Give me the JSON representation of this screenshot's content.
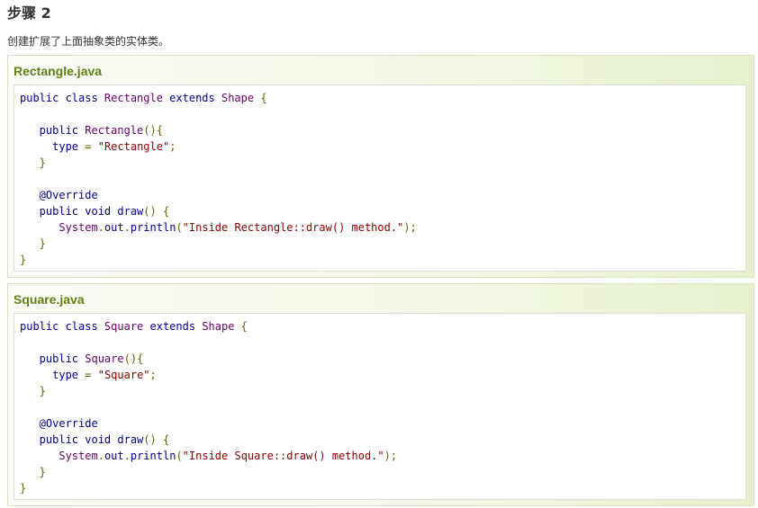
{
  "step": {
    "title": "步骤 2",
    "description": "创建扩展了上面抽象类的实体类。"
  },
  "examples": [
    {
      "filename": "Rectangle.java",
      "lines": [
        [
          {
            "t": "public class ",
            "c": "kw"
          },
          {
            "t": "Rectangle",
            "c": "ty"
          },
          {
            "t": " extends ",
            "c": "kw"
          },
          {
            "t": "Shape",
            "c": "ty"
          },
          {
            "t": " {",
            "c": "pn"
          }
        ],
        [],
        [
          {
            "t": "   public ",
            "c": "kw"
          },
          {
            "t": "Rectangle",
            "c": "ty"
          },
          {
            "t": "(){",
            "c": "pn"
          }
        ],
        [
          {
            "t": "     type",
            "c": "nm"
          },
          {
            "t": " = ",
            "c": "pn"
          },
          {
            "t": "\"Rectangle\"",
            "c": "st"
          },
          {
            "t": ";",
            "c": "pn"
          }
        ],
        [
          {
            "t": "   }",
            "c": "pn"
          }
        ],
        [],
        [
          {
            "t": "   @Override",
            "c": "an"
          }
        ],
        [
          {
            "t": "   public void ",
            "c": "kw"
          },
          {
            "t": "draw",
            "c": "nm"
          },
          {
            "t": "() {",
            "c": "pn"
          }
        ],
        [
          {
            "t": "      System",
            "c": "ty"
          },
          {
            "t": ".",
            "c": "pn"
          },
          {
            "t": "out",
            "c": "nm"
          },
          {
            "t": ".",
            "c": "pn"
          },
          {
            "t": "println",
            "c": "nm"
          },
          {
            "t": "(",
            "c": "pn"
          },
          {
            "t": "\"Inside Rectangle::draw() method.\"",
            "c": "st"
          },
          {
            "t": ");",
            "c": "pn"
          }
        ],
        [
          {
            "t": "   }",
            "c": "pn"
          }
        ],
        [
          {
            "t": "}",
            "c": "pn"
          }
        ]
      ]
    },
    {
      "filename": "Square.java",
      "lines": [
        [
          {
            "t": "public class ",
            "c": "kw"
          },
          {
            "t": "Square",
            "c": "ty"
          },
          {
            "t": " extends ",
            "c": "kw"
          },
          {
            "t": "Shape",
            "c": "ty"
          },
          {
            "t": " {",
            "c": "pn"
          }
        ],
        [],
        [
          {
            "t": "   public ",
            "c": "kw"
          },
          {
            "t": "Square",
            "c": "ty"
          },
          {
            "t": "(){",
            "c": "pn"
          }
        ],
        [
          {
            "t": "     type",
            "c": "nm"
          },
          {
            "t": " = ",
            "c": "pn"
          },
          {
            "t": "\"Square\"",
            "c": "st"
          },
          {
            "t": ";",
            "c": "pn"
          }
        ],
        [
          {
            "t": "   }",
            "c": "pn"
          }
        ],
        [],
        [
          {
            "t": "   @Override",
            "c": "an"
          }
        ],
        [
          {
            "t": "   public void ",
            "c": "kw"
          },
          {
            "t": "draw",
            "c": "nm"
          },
          {
            "t": "() {",
            "c": "pn"
          }
        ],
        [
          {
            "t": "      System",
            "c": "ty"
          },
          {
            "t": ".",
            "c": "pn"
          },
          {
            "t": "out",
            "c": "nm"
          },
          {
            "t": ".",
            "c": "pn"
          },
          {
            "t": "println",
            "c": "nm"
          },
          {
            "t": "(",
            "c": "pn"
          },
          {
            "t": "\"Inside Square::draw() method.\"",
            "c": "st"
          },
          {
            "t": ");",
            "c": "pn"
          }
        ],
        [
          {
            "t": "   }",
            "c": "pn"
          }
        ],
        [
          {
            "t": "}",
            "c": "pn"
          }
        ]
      ]
    }
  ],
  "colors": {
    "title_green": "#617f10",
    "keyword": "#000088",
    "type": "#660066",
    "string": "#880000",
    "punctuation": "#666600"
  }
}
